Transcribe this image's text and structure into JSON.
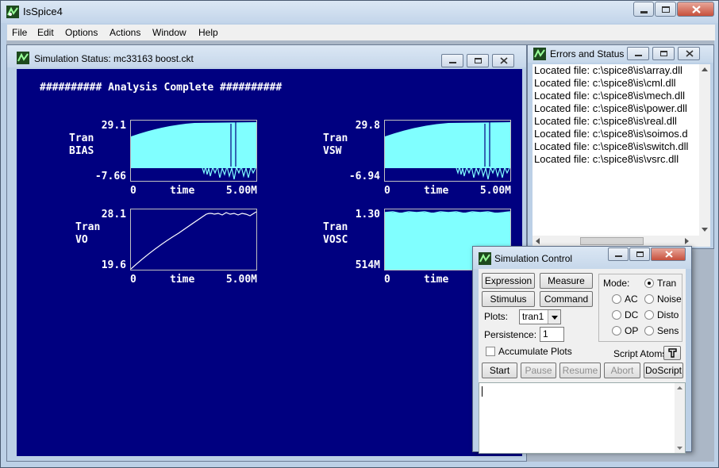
{
  "app": {
    "title": "IsSpice4"
  },
  "menu": [
    "File",
    "Edit",
    "Options",
    "Actions",
    "Window",
    "Help"
  ],
  "sim_status": {
    "title": "Simulation Status: mc33163 boost.ckt",
    "banner": "########## Analysis Complete ##########",
    "plots": [
      {
        "name1": "Tran",
        "name2": "BIAS",
        "ymax": "29.1",
        "ymin": "-7.66",
        "x0": "0",
        "xlabel": "time",
        "xmax": "5.00M"
      },
      {
        "name1": "Tran",
        "name2": "VSW",
        "ymax": "29.8",
        "ymin": "-6.94",
        "x0": "0",
        "xlabel": "time",
        "xmax": "5.00M"
      },
      {
        "name1": "Tran",
        "name2": "VO",
        "ymax": "28.1",
        "ymin": "19.6",
        "x0": "0",
        "xlabel": "time",
        "xmax": "5.00M"
      },
      {
        "name1": "Tran",
        "name2": "VOSC",
        "ymax": "1.30",
        "ymin": "514M",
        "x0": "0",
        "xlabel": "time",
        "xmax": ""
      }
    ]
  },
  "errors": {
    "title": "Errors and Status",
    "lines": [
      "Located file: c:\\spice8\\is\\array.dll",
      "Located file: c:\\spice8\\is\\cml.dll",
      "Located file: c:\\spice8\\is\\mech.dll",
      "Located file: c:\\spice8\\is\\power.dll",
      "Located file: c:\\spice8\\is\\real.dll",
      "Located file: c:\\spice8\\is\\soimos.d",
      "Located file: c:\\spice8\\is\\switch.dll",
      "Located file: c:\\spice8\\is\\vsrc.dll"
    ]
  },
  "sim_control": {
    "title": "Simulation Control",
    "expression": "Expression",
    "measure": "Measure",
    "stimulus": "Stimulus",
    "command": "Command",
    "plots_label": "Plots:",
    "plots_value": "tran1",
    "persistence_label": "Persistence:",
    "persistence_value": "1",
    "accumulate": "Accumulate Plots",
    "mode_label": "Mode:",
    "modes": {
      "tran": "Tran",
      "ac": "AC",
      "noise": "Noise",
      "dc": "DC",
      "disto": "Disto",
      "op": "OP",
      "sens": "Sens"
    },
    "script_atoms": "Script Atoms",
    "start": "Start",
    "pause": "Pause",
    "resume": "Resume",
    "abort": "Abort",
    "doscript": "DoScript"
  },
  "colors": {
    "plot_bg": "#000080",
    "trace": "#80ffff",
    "text": "#ffffff"
  }
}
